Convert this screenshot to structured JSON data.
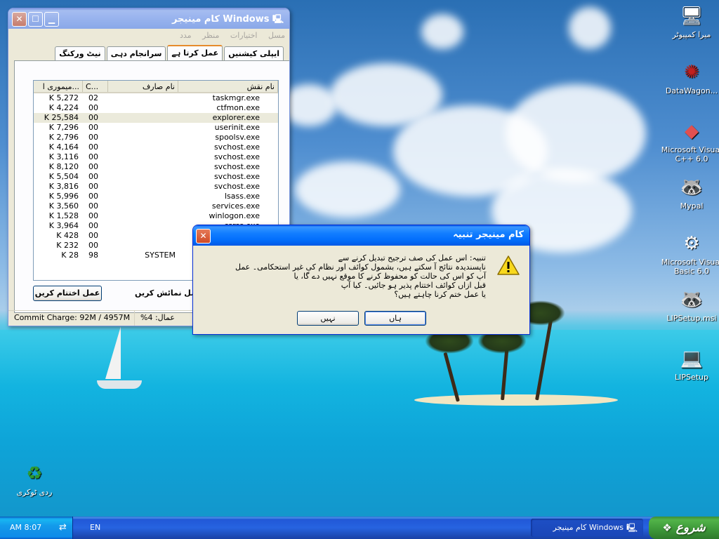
{
  "desktop": {
    "icons": [
      {
        "label": "میرا کمپیوٹر",
        "icon": "computer-icon"
      },
      {
        "label": "DataWagon...",
        "icon": "shortcut-icon"
      },
      {
        "label": "Microsoft Visual C++ 6.0",
        "icon": "visual-cpp-icon"
      },
      {
        "label": "Mypal",
        "icon": "raccoon-icon"
      },
      {
        "label": "Microsoft Visual Basic 6.0",
        "icon": "visual-basic-icon"
      },
      {
        "label": "LIPSetup.msi",
        "icon": "installer-icon"
      },
      {
        "label": "LIPSetup",
        "icon": "setup-icon"
      },
      {
        "label": "ردی ٹوکری",
        "icon": "recycle-bin-icon"
      }
    ]
  },
  "task_manager": {
    "title": "Windows کام مینیجر",
    "menu": [
      "مسل",
      "اختیارات",
      "منظر",
      "مدد"
    ],
    "tabs": [
      "ایپلی کیشنیں",
      "عمل کرتا ہے",
      "سرانجام دہی",
      "نیٹ ورکنگ"
    ],
    "active_tab": "عمل کرتا ہے",
    "columns": {
      "name": "نام نقش",
      "user": "نام صارف",
      "cpu": "C...",
      "mem": "میموری ا..."
    },
    "rows": [
      {
        "name": "taskmgr.exe",
        "user": "",
        "cpu": "02",
        "mem": "K 5,272"
      },
      {
        "name": "ctfmon.exe",
        "user": "",
        "cpu": "00",
        "mem": "K 4,224"
      },
      {
        "name": "explorer.exe",
        "user": "",
        "cpu": "00",
        "mem": "K 25,584"
      },
      {
        "name": "userinit.exe",
        "user": "",
        "cpu": "00",
        "mem": "K 7,296"
      },
      {
        "name": "spoolsv.exe",
        "user": "",
        "cpu": "00",
        "mem": "K 2,796"
      },
      {
        "name": "svchost.exe",
        "user": "",
        "cpu": "00",
        "mem": "K 4,164"
      },
      {
        "name": "svchost.exe",
        "user": "",
        "cpu": "00",
        "mem": "K 3,116"
      },
      {
        "name": "svchost.exe",
        "user": "",
        "cpu": "00",
        "mem": "K 8,120"
      },
      {
        "name": "svchost.exe",
        "user": "",
        "cpu": "00",
        "mem": "K 5,504"
      },
      {
        "name": "svchost.exe",
        "user": "",
        "cpu": "00",
        "mem": "K 3,816"
      },
      {
        "name": "lsass.exe",
        "user": "",
        "cpu": "00",
        "mem": "K 5,996"
      },
      {
        "name": "services.exe",
        "user": "",
        "cpu": "00",
        "mem": "K 3,560"
      },
      {
        "name": "winlogon.exe",
        "user": "",
        "cpu": "00",
        "mem": "K 1,528"
      },
      {
        "name": "csrss.exe",
        "user": "",
        "cpu": "00",
        "mem": "K 3,964"
      },
      {
        "name": "",
        "user": "",
        "cpu": "00",
        "mem": "K 428"
      },
      {
        "name": "",
        "user": "",
        "cpu": "00",
        "mem": "K 232"
      },
      {
        "name": "",
        "user": "SYSTEM",
        "cpu": "98",
        "mem": "K 28"
      }
    ],
    "selected_row": 2,
    "end_process_button": "عمل اختتام کریں",
    "show_all_label": "عمل نمائش کریں",
    "status": {
      "commit": "Commit Charge: 92M / 4957M",
      "cpu": "%4 :عمال"
    }
  },
  "dialog": {
    "title": "کام مینیجر تنبیہ",
    "message": [
      "تنبیہ: اس عمل کی صف ترجیح تبدیل کرنے سے",
      "ناپسندیدہ نتائج آ سکتے ہیں، بشمول کوائف اور نظام کی غیر استحکامی۔ عمل",
      "آپ کو اس کی حالت کو محفوظ کرنے کا موقع نہیں دے گا، یا",
      "قبل ازاں کوائف اختتام پذیر ہو جائیں۔ کیا آپ",
      "یا عمل ختم کرنا چاہتے ہیں؟"
    ],
    "yes_button": "ہاں",
    "no_button": "نہیں"
  },
  "taskbar": {
    "start_label": "شروع",
    "task_item": "Windows کام مینیجر",
    "language": "EN",
    "clock": "AM 8:07"
  }
}
